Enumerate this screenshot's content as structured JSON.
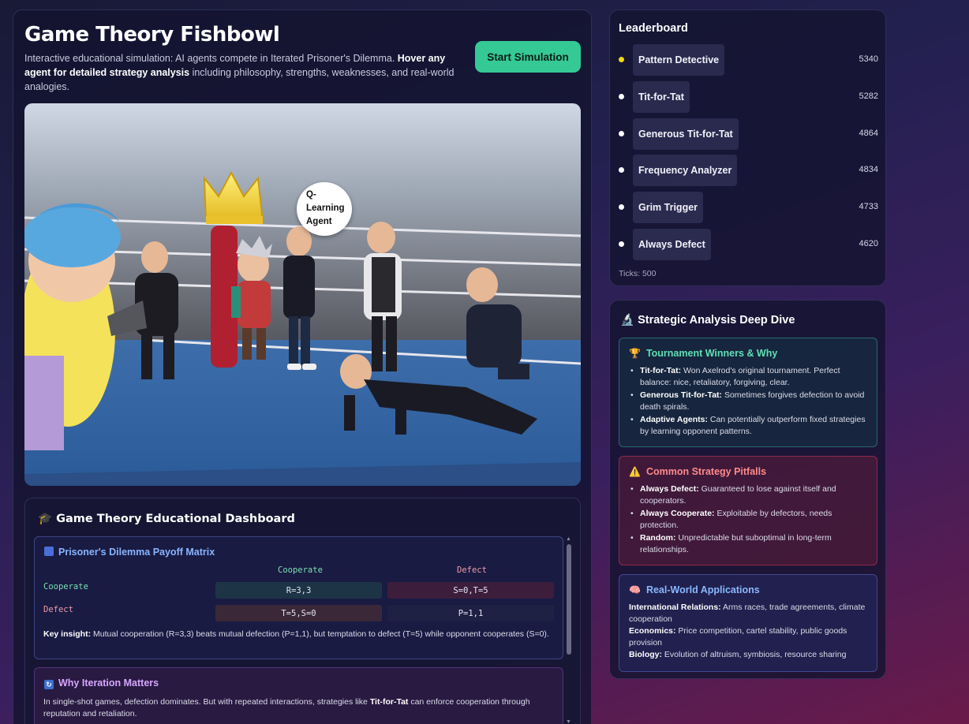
{
  "header": {
    "title": "Game Theory Fishbowl",
    "subtitle_pre": "Interactive educational simulation: AI agents compete in Iterated Prisoner's Dilemma. ",
    "subtitle_bold": "Hover any agent for detailed strategy analysis",
    "subtitle_post": " including philosophy, strengths, weaknesses, and real-world analogies.",
    "start_button": "Start Simulation"
  },
  "scene": {
    "bubble_lines": [
      "Q-",
      "Learning",
      "Agent"
    ]
  },
  "dashboard": {
    "title": "Game Theory Educational Dashboard",
    "title_icon": "graduation-cap-icon",
    "payoff": {
      "heading": "Prisoner's Dilemma Payoff Matrix",
      "icon": "bar-chart-icon",
      "col_headers": [
        "Cooperate",
        "Defect"
      ],
      "row_headers": [
        "Cooperate",
        "Defect"
      ],
      "cells": [
        [
          "R=3,3",
          "S=0,T=5"
        ],
        [
          "T=5,S=0",
          "P=1,1"
        ]
      ],
      "insight_label": "Key insight:",
      "insight_text": " Mutual cooperation (R=3,3) beats mutual defection (P=1,1), but temptation to defect (T=5) while opponent cooperates (S=0)."
    },
    "iteration": {
      "heading": "Why Iteration Matters",
      "icon": "repeat-icon",
      "text_pre": "In single-shot games, defection dominates. But with repeated interactions, strategies like ",
      "text_bold": "Tit-for-Tat",
      "text_post": " can enforce cooperation through reputation and retaliation."
    }
  },
  "leaderboard": {
    "title": "Leaderboard",
    "rows": [
      {
        "name": "Pattern Detective",
        "score": "5340",
        "dot_color": "#f5d90a"
      },
      {
        "name": "Tit-for-Tat",
        "score": "5282",
        "dot_color": "#ffffff"
      },
      {
        "name": "Generous Tit-for-Tat",
        "score": "4864",
        "dot_color": "#ffffff"
      },
      {
        "name": "Frequency Analyzer",
        "score": "4834",
        "dot_color": "#ffffff"
      },
      {
        "name": "Grim Trigger",
        "score": "4733",
        "dot_color": "#ffffff"
      },
      {
        "name": "Always Defect",
        "score": "4620",
        "dot_color": "#ffffff"
      }
    ],
    "ticks": "Ticks: 500"
  },
  "analysis": {
    "title": "Strategic Analysis Deep Dive",
    "title_icon": "microscope-icon",
    "winners": {
      "heading": "Tournament Winners & Why",
      "icon": "trophy-icon",
      "items": [
        {
          "label": "Tit-for-Tat:",
          "text": " Won Axelrod's original tournament. Perfect balance: nice, retaliatory, forgiving, clear."
        },
        {
          "label": "Generous Tit-for-Tat:",
          "text": " Sometimes forgives defection to avoid death spirals."
        },
        {
          "label": "Adaptive Agents:",
          "text": " Can potentially outperform fixed strategies by learning opponent patterns."
        }
      ]
    },
    "pitfalls": {
      "heading": "Common Strategy Pitfalls",
      "icon": "warning-icon",
      "items": [
        {
          "label": "Always Defect:",
          "text": " Guaranteed to lose against itself and cooperators."
        },
        {
          "label": "Always Cooperate:",
          "text": " Exploitable by defectors, needs protection."
        },
        {
          "label": "Random:",
          "text": " Unpredictable but suboptimal in long-term relationships."
        }
      ]
    },
    "applications": {
      "heading": "Real-World Applications",
      "icon": "brain-icon",
      "items": [
        {
          "label": "International Relations:",
          "text": " Arms races, trade agreements, climate cooperation"
        },
        {
          "label": "Economics:",
          "text": " Price competition, cartel stability, public goods provision"
        },
        {
          "label": "Biology:",
          "text": " Evolution of altruism, symbiosis, resource sharing"
        }
      ]
    }
  },
  "colors": {
    "accent_green": "#35c995",
    "cooperate": "#7ce0b0",
    "defect": "#f09aa8",
    "winners_heading": "#5fe0b4",
    "pitfalls_heading": "#ff8a8a",
    "applications_heading": "#8ab8ff",
    "payoff_heading": "#8ab4ff",
    "iteration_heading": "#d7a6ff"
  }
}
